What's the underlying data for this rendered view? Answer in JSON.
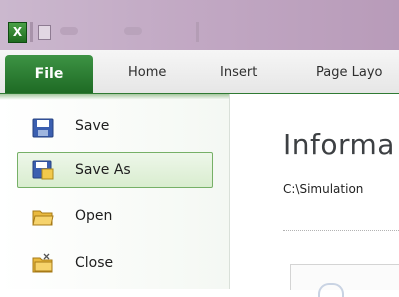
{
  "window": {
    "app_icon_letter": "X"
  },
  "ribbon": {
    "tabs": [
      {
        "label": "File",
        "selected": true
      },
      {
        "label": "Home"
      },
      {
        "label": "Insert"
      },
      {
        "label": "Page Layo"
      }
    ],
    "accent_color": "#2e7d32"
  },
  "backstage": {
    "menu": [
      {
        "label": "Save",
        "icon": "save-icon"
      },
      {
        "label": "Save As",
        "icon": "save-as-icon",
        "selected": true
      },
      {
        "label": "Open",
        "icon": "open-folder-icon"
      },
      {
        "label": "Close",
        "icon": "close-folder-icon"
      }
    ]
  },
  "info": {
    "title": "Informa",
    "path": "C:\\Simulation"
  }
}
